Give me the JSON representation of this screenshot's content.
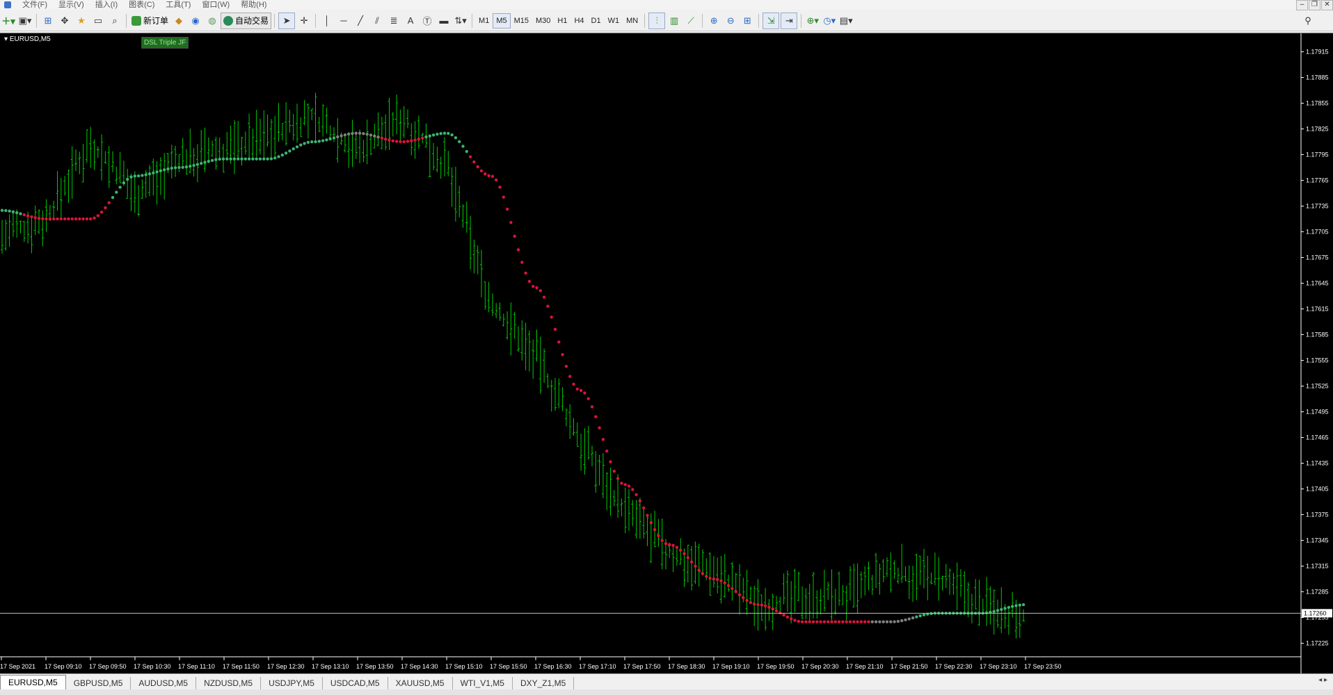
{
  "menu": [
    "文件(F)",
    "显示(V)",
    "插入(I)",
    "图表(C)",
    "工具(T)",
    "窗口(W)",
    "帮助(H)"
  ],
  "toolbar": {
    "new_order": "新订单",
    "auto_trading": "自动交易",
    "timeframes": [
      "M1",
      "M5",
      "M15",
      "M30",
      "H1",
      "H4",
      "D1",
      "W1",
      "MN"
    ],
    "active_timeframe": "M5"
  },
  "chart": {
    "symbol_title": "EURUSD,M5",
    "indicator_label": "DSL Triple JF",
    "current_price": "1.17260",
    "colors": {
      "background": "#000000",
      "bars": "#00cc00",
      "dsl_up": "#3cb371",
      "dsl_down": "#dc143c",
      "dsl_neutral": "#808080",
      "axis_text": "#ffffff"
    }
  },
  "chart_data": {
    "type": "ohlc",
    "symbol": "EURUSD",
    "timeframe": "M5",
    "ylim": [
      1.1721,
      1.1793
    ],
    "y_ticks": [
      "1.17915",
      "1.17885",
      "1.17855",
      "1.17825",
      "1.17795",
      "1.17765",
      "1.17735",
      "1.17705",
      "1.17675",
      "1.17645",
      "1.17615",
      "1.17585",
      "1.17555",
      "1.17525",
      "1.17495",
      "1.17465",
      "1.17435",
      "1.17405",
      "1.17375",
      "1.17345",
      "1.17315",
      "1.17285",
      "1.17255",
      "1.17225"
    ],
    "x_ticks": [
      "17 Sep 2021",
      "17 Sep 09:10",
      "17 Sep 09:50",
      "17 Sep 10:30",
      "17 Sep 11:10",
      "17 Sep 11:50",
      "17 Sep 12:30",
      "17 Sep 13:10",
      "17 Sep 13:50",
      "17 Sep 14:30",
      "17 Sep 15:10",
      "17 Sep 15:50",
      "17 Sep 16:30",
      "17 Sep 17:10",
      "17 Sep 17:50",
      "17 Sep 18:30",
      "17 Sep 19:10",
      "17 Sep 19:50",
      "17 Sep 20:30",
      "17 Sep 21:10",
      "17 Sep 21:50",
      "17 Sep 22:30",
      "17 Sep 23:10",
      "17 Sep 23:50"
    ],
    "close_path": [
      {
        "time": "17 Sep 08:30",
        "price": 1.177
      },
      {
        "time": "17 Sep 09:10",
        "price": 1.1772
      },
      {
        "time": "17 Sep 09:50",
        "price": 1.1781
      },
      {
        "time": "17 Sep 10:30",
        "price": 1.1775
      },
      {
        "time": "17 Sep 11:10",
        "price": 1.1779
      },
      {
        "time": "17 Sep 11:50",
        "price": 1.178
      },
      {
        "time": "17 Sep 12:30",
        "price": 1.1782
      },
      {
        "time": "17 Sep 13:10",
        "price": 1.1784
      },
      {
        "time": "17 Sep 13:50",
        "price": 1.178
      },
      {
        "time": "17 Sep 14:30",
        "price": 1.1784
      },
      {
        "time": "17 Sep 15:10",
        "price": 1.1778
      },
      {
        "time": "17 Sep 15:50",
        "price": 1.1762
      },
      {
        "time": "17 Sep 16:30",
        "price": 1.1756
      },
      {
        "time": "17 Sep 17:10",
        "price": 1.1746
      },
      {
        "time": "17 Sep 17:50",
        "price": 1.1738
      },
      {
        "time": "17 Sep 18:30",
        "price": 1.1733
      },
      {
        "time": "17 Sep 19:10",
        "price": 1.1731
      },
      {
        "time": "17 Sep 19:50",
        "price": 1.1727
      },
      {
        "time": "17 Sep 20:30",
        "price": 1.1728
      },
      {
        "time": "17 Sep 21:10",
        "price": 1.1728
      },
      {
        "time": "17 Sep 21:50",
        "price": 1.1731
      },
      {
        "time": "17 Sep 22:30",
        "price": 1.173
      },
      {
        "time": "17 Sep 23:10",
        "price": 1.1727
      },
      {
        "time": "17 Sep 23:50",
        "price": 1.1726
      }
    ],
    "dsl_line": [
      {
        "time": "17 Sep 08:30",
        "value": 1.1773,
        "state": "up"
      },
      {
        "time": "17 Sep 09:10",
        "value": 1.1772,
        "state": "down"
      },
      {
        "time": "17 Sep 09:50",
        "value": 1.1772,
        "state": "down"
      },
      {
        "time": "17 Sep 10:30",
        "value": 1.1777,
        "state": "up"
      },
      {
        "time": "17 Sep 11:10",
        "value": 1.1778,
        "state": "up"
      },
      {
        "time": "17 Sep 11:50",
        "value": 1.1779,
        "state": "up"
      },
      {
        "time": "17 Sep 12:30",
        "value": 1.1779,
        "state": "up"
      },
      {
        "time": "17 Sep 13:10",
        "value": 1.1781,
        "state": "up"
      },
      {
        "time": "17 Sep 13:50",
        "value": 1.1782,
        "state": "neutral"
      },
      {
        "time": "17 Sep 14:30",
        "value": 1.1781,
        "state": "down"
      },
      {
        "time": "17 Sep 15:10",
        "value": 1.1782,
        "state": "up"
      },
      {
        "time": "17 Sep 15:50",
        "value": 1.1777,
        "state": "down"
      },
      {
        "time": "17 Sep 16:30",
        "value": 1.1764,
        "state": "down"
      },
      {
        "time": "17 Sep 17:10",
        "value": 1.1752,
        "state": "down"
      },
      {
        "time": "17 Sep 17:50",
        "value": 1.1741,
        "state": "down"
      },
      {
        "time": "17 Sep 18:30",
        "value": 1.1734,
        "state": "down"
      },
      {
        "time": "17 Sep 19:10",
        "value": 1.173,
        "state": "down"
      },
      {
        "time": "17 Sep 19:50",
        "value": 1.1727,
        "state": "down"
      },
      {
        "time": "17 Sep 20:30",
        "value": 1.1725,
        "state": "down"
      },
      {
        "time": "17 Sep 21:10",
        "value": 1.1725,
        "state": "down"
      },
      {
        "time": "17 Sep 21:50",
        "value": 1.1725,
        "state": "neutral"
      },
      {
        "time": "17 Sep 22:30",
        "value": 1.1726,
        "state": "up"
      },
      {
        "time": "17 Sep 23:10",
        "value": 1.1726,
        "state": "up"
      },
      {
        "time": "17 Sep 23:50",
        "value": 1.1727,
        "state": "up"
      }
    ]
  },
  "tabs": [
    "EURUSD,M5",
    "GBPUSD,M5",
    "AUDUSD,M5",
    "NZDUSD,M5",
    "USDJPY,M5",
    "USDCAD,M5",
    "XAUUSD,M5",
    "WTI_V1,M5",
    "DXY_Z1,M5"
  ],
  "active_tab": "EURUSD,M5",
  "tab_nav": "◂ ▸"
}
